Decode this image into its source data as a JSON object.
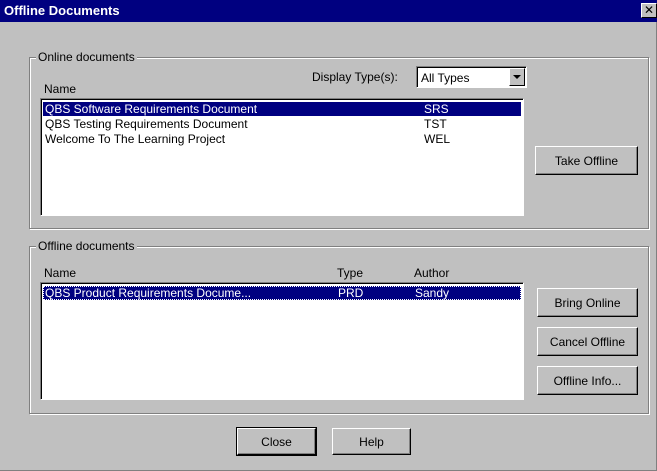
{
  "window": {
    "title": "Offline Documents",
    "close_glyph": "✕"
  },
  "online": {
    "group_label": "Online documents",
    "col_name": "Name",
    "display_type_label": "Display Type(s):",
    "display_type_value": "All Types",
    "rows": [
      {
        "name": "QBS Software Requirements Document",
        "type": "SRS",
        "selected": true
      },
      {
        "name": "QBS Testing Requirements Document",
        "type": "TST",
        "selected": false
      },
      {
        "name": "Welcome To The Learning Project",
        "type": "WEL",
        "selected": false
      }
    ],
    "take_offline_label": "Take Offline"
  },
  "offline": {
    "group_label": "Offline documents",
    "col_name": "Name",
    "col_type": "Type",
    "col_author": "Author",
    "rows": [
      {
        "name": "QBS Product Requirements Docume...",
        "type": "PRD",
        "author": "Sandy",
        "selected": true
      }
    ],
    "bring_online_label": "Bring Online",
    "cancel_offline_label": "Cancel Offline",
    "offline_info_label": "Offline Info..."
  },
  "footer": {
    "close_label": "Close",
    "help_label": "Help"
  }
}
